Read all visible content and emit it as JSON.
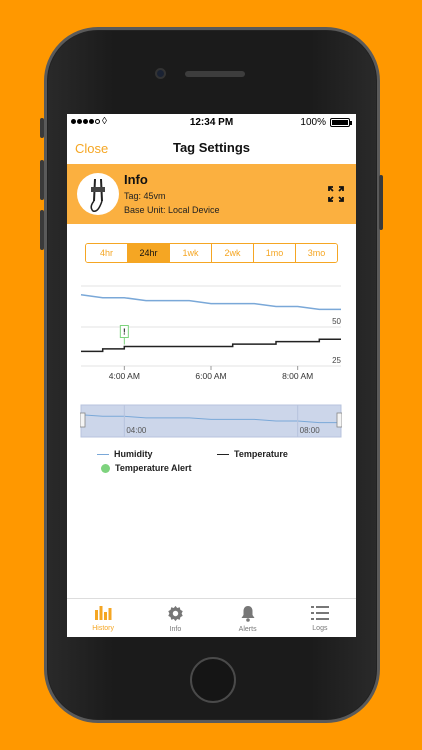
{
  "status": {
    "time": "12:34 PM",
    "battery": "100%"
  },
  "nav": {
    "close_label": "Close",
    "title": "Tag Settings"
  },
  "info": {
    "title": "Info",
    "tag": "Tag: 45vm",
    "base_unit": "Base Unit: Local Device",
    "expand_icon": "expand-icon"
  },
  "ranges": [
    {
      "label": "4hr",
      "active": false
    },
    {
      "label": "24hr",
      "active": true
    },
    {
      "label": "1wk",
      "active": false
    },
    {
      "label": "2wk",
      "active": false
    },
    {
      "label": "1mo",
      "active": false
    },
    {
      "label": "3mo",
      "active": false
    }
  ],
  "chart_data": {
    "type": "line",
    "x": [
      "03:00",
      "03:30",
      "04:00",
      "04:30",
      "05:00",
      "05:30",
      "06:00",
      "06:30",
      "07:00",
      "07:30",
      "08:00",
      "08:30",
      "09:00"
    ],
    "x_ticks": [
      "4:00 AM",
      "6:00 AM",
      "8:00 AM"
    ],
    "series": [
      {
        "name": "Humidity",
        "color": "#7aa8d8",
        "values": [
          55,
          54,
          54,
          53,
          53,
          53,
          52,
          52,
          52,
          51,
          51,
          50,
          50
        ]
      },
      {
        "name": "Temperature",
        "color": "#222222",
        "values": [
          23,
          23.5,
          24,
          24,
          24,
          24,
          24,
          24.5,
          24.5,
          25,
          25,
          25.5,
          25.5
        ]
      }
    ],
    "y_labels": [
      "50",
      "25"
    ],
    "alert": {
      "name": "Temperature Alert",
      "color": "#7ed37e",
      "symbol": "!",
      "at": "04:00"
    },
    "navigator_ticks": [
      "04:00",
      "08:00"
    ]
  },
  "legend": {
    "humidity": "Humidity",
    "temperature": "Temperature",
    "alert": "Temperature Alert"
  },
  "tabs": [
    {
      "label": "History",
      "icon": "bar-chart-icon",
      "active": true
    },
    {
      "label": "Info",
      "icon": "gear-icon",
      "active": false
    },
    {
      "label": "Alerts",
      "icon": "bell-icon",
      "active": false
    },
    {
      "label": "Logs",
      "icon": "list-icon",
      "active": false
    }
  ]
}
